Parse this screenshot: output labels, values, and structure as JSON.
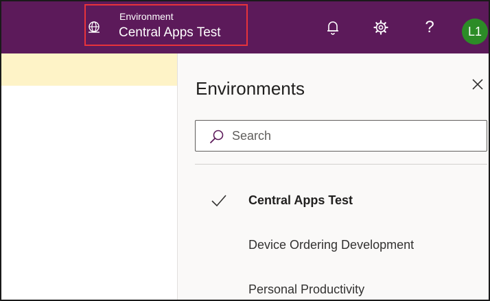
{
  "header": {
    "environment_label": "Environment",
    "environment_name": "Central Apps Test",
    "icons": [
      "globe-icon",
      "bell-icon",
      "gear-icon",
      "help-icon"
    ],
    "help_glyph": "?",
    "avatar_initials": "L1",
    "colors": {
      "bar": "#5c1a5a",
      "highlight_border": "#e8333b",
      "avatar": "#2c8c27"
    }
  },
  "panel": {
    "title": "Environments",
    "search": {
      "placeholder": "Search",
      "value": ""
    },
    "environments": [
      {
        "label": "Central Apps Test",
        "selected": true
      },
      {
        "label": "Device Ordering Development",
        "selected": false
      },
      {
        "label": "Personal Productivity",
        "selected": false
      }
    ]
  },
  "banner": {
    "color": "#fef3c7"
  }
}
